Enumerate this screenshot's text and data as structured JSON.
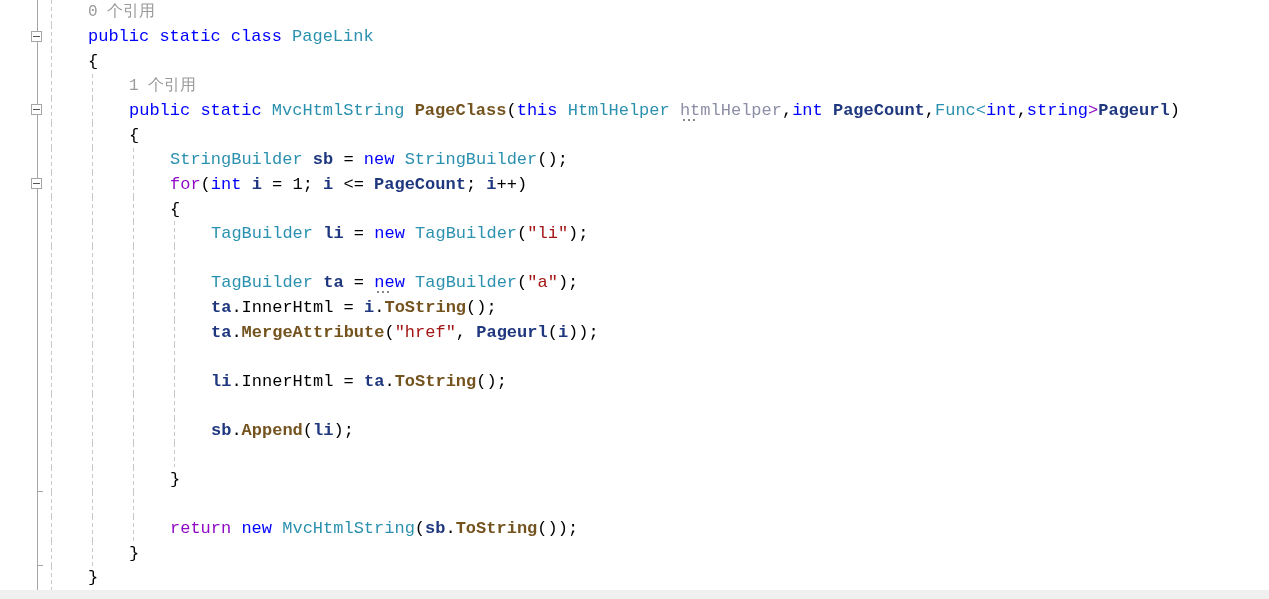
{
  "editor": {
    "lines": [
      {
        "kind": "hint",
        "text": "0 个引用"
      },
      {
        "kind": "code",
        "expanded": true,
        "tokens": [
          {
            "text": "public static class ",
            "kind": "keyword"
          },
          {
            "text": "PageLink",
            "kind": "type"
          }
        ]
      },
      {
        "kind": "code",
        "tokens": [
          {
            "text": "{",
            "kind": "plain"
          }
        ]
      },
      {
        "kind": "block",
        "children": [
          {
            "kind": "hint",
            "text": "1 个引用"
          },
          {
            "kind": "code",
            "expanded": true,
            "tokens": [
              {
                "text": "public static ",
                "kind": "keyword"
              },
              {
                "text": "MvcHtmlString ",
                "kind": "type"
              },
              {
                "text": "PageClass",
                "kind": "method"
              },
              {
                "text": "(",
                "kind": "plain"
              },
              {
                "text": "this ",
                "kind": "keyword"
              },
              {
                "text": "HtmlHelper ",
                "kind": "type"
              },
              {
                "text": "htmlHelper",
                "kind": "unused",
                "dots": true
              },
              {
                "text": ",",
                "kind": "plain"
              },
              {
                "text": "int ",
                "kind": "keyword"
              },
              {
                "text": "PageCount",
                "kind": "local"
              },
              {
                "text": ",",
                "kind": "plain"
              },
              {
                "text": "Func",
                "kind": "type"
              },
              {
                "text": "<",
                "kind": "type"
              },
              {
                "text": "int",
                "kind": "keyword"
              },
              {
                "text": ",",
                "kind": "plain"
              },
              {
                "text": "string",
                "kind": "keyword"
              },
              {
                "text": ">",
                "kind": "control"
              },
              {
                "text": "Pageurl",
                "kind": "local"
              },
              {
                "text": ")",
                "kind": "plain"
              }
            ]
          },
          {
            "kind": "code",
            "tokens": [
              {
                "text": "{",
                "kind": "plain"
              }
            ]
          },
          {
            "kind": "block",
            "children": [
              {
                "kind": "code",
                "tokens": [
                  {
                    "text": "StringBuilder ",
                    "kind": "type"
                  },
                  {
                    "text": "sb",
                    "kind": "local"
                  },
                  {
                    "text": " = ",
                    "kind": "plain"
                  },
                  {
                    "text": "new ",
                    "kind": "keyword"
                  },
                  {
                    "text": "StringBuilder",
                    "kind": "type"
                  },
                  {
                    "text": "();",
                    "kind": "plain"
                  }
                ]
              },
              {
                "kind": "code",
                "expanded": true,
                "tokens": [
                  {
                    "text": "for",
                    "kind": "control"
                  },
                  {
                    "text": "(",
                    "kind": "plain"
                  },
                  {
                    "text": "int ",
                    "kind": "keyword"
                  },
                  {
                    "text": "i",
                    "kind": "local"
                  },
                  {
                    "text": " = 1; ",
                    "kind": "plain"
                  },
                  {
                    "text": "i",
                    "kind": "local"
                  },
                  {
                    "text": " <= ",
                    "kind": "plain"
                  },
                  {
                    "text": "PageCount",
                    "kind": "local"
                  },
                  {
                    "text": "; ",
                    "kind": "plain"
                  },
                  {
                    "text": "i",
                    "kind": "local"
                  },
                  {
                    "text": "++)",
                    "kind": "plain"
                  }
                ]
              },
              {
                "kind": "code",
                "tokens": [
                  {
                    "text": "{",
                    "kind": "plain"
                  }
                ]
              },
              {
                "kind": "block",
                "children": [
                  {
                    "kind": "code",
                    "tokens": [
                      {
                        "text": "TagBuilder ",
                        "kind": "type"
                      },
                      {
                        "text": "li",
                        "kind": "local"
                      },
                      {
                        "text": " = ",
                        "kind": "plain"
                      },
                      {
                        "text": "new ",
                        "kind": "keyword"
                      },
                      {
                        "text": "TagBuilder",
                        "kind": "type"
                      },
                      {
                        "text": "(",
                        "kind": "plain"
                      },
                      {
                        "text": "\"li\"",
                        "kind": "string"
                      },
                      {
                        "text": ");",
                        "kind": "plain"
                      }
                    ]
                  },
                  {
                    "kind": "blank"
                  },
                  {
                    "kind": "code",
                    "tokens": [
                      {
                        "text": "TagBuilder ",
                        "kind": "type"
                      },
                      {
                        "text": "ta",
                        "kind": "local"
                      },
                      {
                        "text": " = ",
                        "kind": "plain"
                      },
                      {
                        "text": "new ",
                        "kind": "keyword",
                        "dots": true
                      },
                      {
                        "text": "TagBuilder",
                        "kind": "type"
                      },
                      {
                        "text": "(",
                        "kind": "plain"
                      },
                      {
                        "text": "\"a\"",
                        "kind": "string"
                      },
                      {
                        "text": ");",
                        "kind": "plain"
                      }
                    ]
                  },
                  {
                    "kind": "code",
                    "tokens": [
                      {
                        "text": "ta",
                        "kind": "local"
                      },
                      {
                        "text": ".InnerHtml = ",
                        "kind": "plain"
                      },
                      {
                        "text": "i",
                        "kind": "local"
                      },
                      {
                        "text": ".",
                        "kind": "plain"
                      },
                      {
                        "text": "ToString",
                        "kind": "method"
                      },
                      {
                        "text": "();",
                        "kind": "plain"
                      }
                    ]
                  },
                  {
                    "kind": "code",
                    "tokens": [
                      {
                        "text": "ta",
                        "kind": "local"
                      },
                      {
                        "text": ".",
                        "kind": "plain"
                      },
                      {
                        "text": "MergeAttribute",
                        "kind": "method"
                      },
                      {
                        "text": "(",
                        "kind": "plain"
                      },
                      {
                        "text": "\"href\"",
                        "kind": "string"
                      },
                      {
                        "text": ", ",
                        "kind": "plain"
                      },
                      {
                        "text": "Pageurl",
                        "kind": "local"
                      },
                      {
                        "text": "(",
                        "kind": "plain"
                      },
                      {
                        "text": "i",
                        "kind": "local"
                      },
                      {
                        "text": "));",
                        "kind": "plain"
                      }
                    ]
                  },
                  {
                    "kind": "blank"
                  },
                  {
                    "kind": "code",
                    "tokens": [
                      {
                        "text": "li",
                        "kind": "local"
                      },
                      {
                        "text": ".InnerHtml = ",
                        "kind": "plain"
                      },
                      {
                        "text": "ta",
                        "kind": "local"
                      },
                      {
                        "text": ".",
                        "kind": "plain"
                      },
                      {
                        "text": "ToString",
                        "kind": "method"
                      },
                      {
                        "text": "();",
                        "kind": "plain"
                      }
                    ]
                  },
                  {
                    "kind": "blank"
                  },
                  {
                    "kind": "code",
                    "tokens": [
                      {
                        "text": "sb",
                        "kind": "local"
                      },
                      {
                        "text": ".",
                        "kind": "plain"
                      },
                      {
                        "text": "Append",
                        "kind": "method"
                      },
                      {
                        "text": "(",
                        "kind": "plain"
                      },
                      {
                        "text": "li",
                        "kind": "local"
                      },
                      {
                        "text": ");",
                        "kind": "plain"
                      }
                    ]
                  },
                  {
                    "kind": "blank"
                  }
                ]
              },
              {
                "kind": "code",
                "fold_end": true,
                "tokens": [
                  {
                    "text": "}",
                    "kind": "plain"
                  }
                ]
              },
              {
                "kind": "blank"
              },
              {
                "kind": "code",
                "tokens": [
                  {
                    "text": "return ",
                    "kind": "control"
                  },
                  {
                    "text": "new ",
                    "kind": "keyword"
                  },
                  {
                    "text": "MvcHtmlString",
                    "kind": "type"
                  },
                  {
                    "text": "(",
                    "kind": "plain"
                  },
                  {
                    "text": "sb",
                    "kind": "local"
                  },
                  {
                    "text": ".",
                    "kind": "plain"
                  },
                  {
                    "text": "ToString",
                    "kind": "method"
                  },
                  {
                    "text": "());",
                    "kind": "plain"
                  }
                ]
              }
            ]
          },
          {
            "kind": "code",
            "fold_end": true,
            "tokens": [
              {
                "text": "}",
                "kind": "plain"
              }
            ]
          }
        ]
      },
      {
        "kind": "code",
        "tokens": [
          {
            "text": "}",
            "kind": "plain"
          }
        ]
      }
    ]
  }
}
